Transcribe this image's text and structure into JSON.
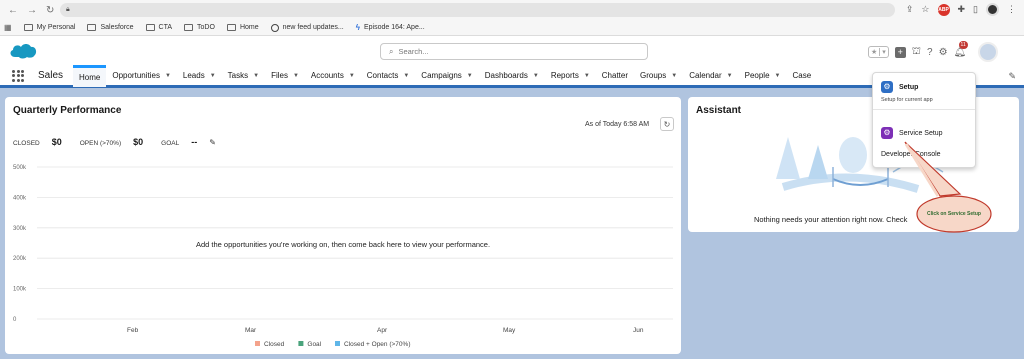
{
  "browser": {
    "url": "",
    "bookmarks": [
      "My Personal",
      "Salesforce",
      "CTA",
      "ToDO",
      "Home",
      "new feed updates...",
      "Episode 164: Ape..."
    ],
    "extension_badge": "ABP"
  },
  "header": {
    "search_placeholder": "Search...",
    "notification_count": "11"
  },
  "nav": {
    "app_name": "Sales",
    "tabs": [
      {
        "label": "Home",
        "dropdown": false
      },
      {
        "label": "Opportunities",
        "dropdown": true
      },
      {
        "label": "Leads",
        "dropdown": true
      },
      {
        "label": "Tasks",
        "dropdown": true
      },
      {
        "label": "Files",
        "dropdown": true
      },
      {
        "label": "Accounts",
        "dropdown": true
      },
      {
        "label": "Contacts",
        "dropdown": true
      },
      {
        "label": "Campaigns",
        "dropdown": true
      },
      {
        "label": "Dashboards",
        "dropdown": true
      },
      {
        "label": "Reports",
        "dropdown": true
      },
      {
        "label": "Chatter",
        "dropdown": false
      },
      {
        "label": "Groups",
        "dropdown": true
      },
      {
        "label": "Calendar",
        "dropdown": true
      },
      {
        "label": "People",
        "dropdown": true
      },
      {
        "label": "Case",
        "dropdown": false
      }
    ]
  },
  "quarterly": {
    "title": "Quarterly Performance",
    "as_of": "As of Today 6:58 AM",
    "closed_label": "CLOSED",
    "closed_value": "$0",
    "open_label": "OPEN (>70%)",
    "open_value": "$0",
    "goal_label": "GOAL",
    "goal_value": "--",
    "empty_message": "Add the opportunities you're working on, then come back here to view your performance.",
    "y_ticks": [
      "500k",
      "400k",
      "300k",
      "200k",
      "100k",
      "0"
    ],
    "x_ticks": [
      "Feb",
      "Mar",
      "Apr",
      "May",
      "Jun"
    ],
    "legend": [
      {
        "label": "Closed",
        "color": "#f4a38c"
      },
      {
        "label": "Goal",
        "color": "#4aa37c"
      },
      {
        "label": "Closed + Open (>70%)",
        "color": "#5fb6e8"
      }
    ]
  },
  "assistant": {
    "title": "Assistant",
    "message": "Nothing needs your attention right now. Check"
  },
  "setup_menu": {
    "setup_label": "Setup",
    "setup_sub": "Setup for current app",
    "service_setup_label": "Service Setup",
    "dev_console_label": "Developer Console"
  },
  "callout": {
    "text": "Click on Service Setup"
  },
  "colors": {
    "nav_accent": "#2d6bb6",
    "page_bg": "#b0c4df",
    "callout_fill": "#f7d7c8",
    "callout_stroke": "#c0392b"
  }
}
